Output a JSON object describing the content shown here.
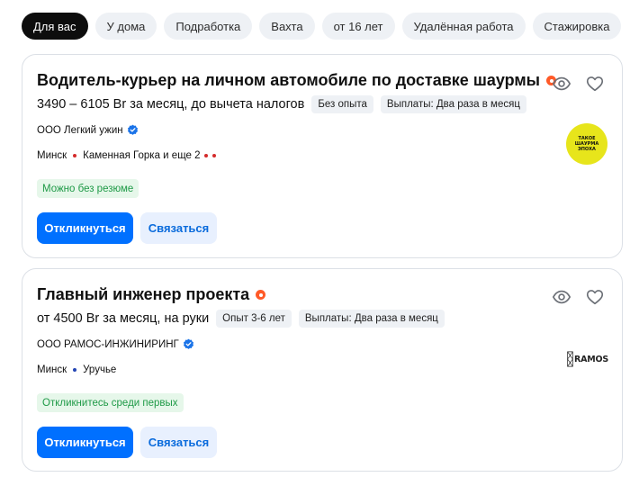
{
  "filters": [
    "Для вас",
    "У дома",
    "Подработка",
    "Вахта",
    "от 16 лет",
    "Удалённая работа",
    "Стажировка"
  ],
  "colors": {
    "accent": "#0070ff",
    "hot": "#ff5a28",
    "verified": "#1a73e8",
    "metro_red": "#d42b2b",
    "metro_blue": "#2446b4",
    "green_badge": "#1f9a47"
  },
  "vacancies": [
    {
      "title": "Водитель-курьер на личном автомобиле по доставке шаурмы",
      "salary": "3490 – 6105 Br за месяц, до вычета налогов",
      "experience": "Без опыта",
      "payouts": "Выплаты: Два раза в месяц",
      "company": "ООО Легкий ужин",
      "city": "Минск",
      "metro": "Каменная Горка и еще 2",
      "badge": "Можно без резюме",
      "apply_label": "Откликнуться",
      "contact_label": "Связаться",
      "logo_lines": [
        "ТАКОЕ",
        "ШАУРМА",
        "ЭПОХА"
      ]
    },
    {
      "title": "Главный инженер проекта",
      "salary": "от 4500 Br за месяц, на руки",
      "experience": "Опыт 3-6 лет",
      "payouts": "Выплаты: Два раза в месяц",
      "company": "ООО РАМОС-ИНЖИНИРИНГ",
      "city": "Минск",
      "metro": "Уручье",
      "badge": "Откликнитесь среди первых",
      "apply_label": "Откликнуться",
      "contact_label": "Связаться",
      "logo_text": "RAMOS"
    }
  ]
}
